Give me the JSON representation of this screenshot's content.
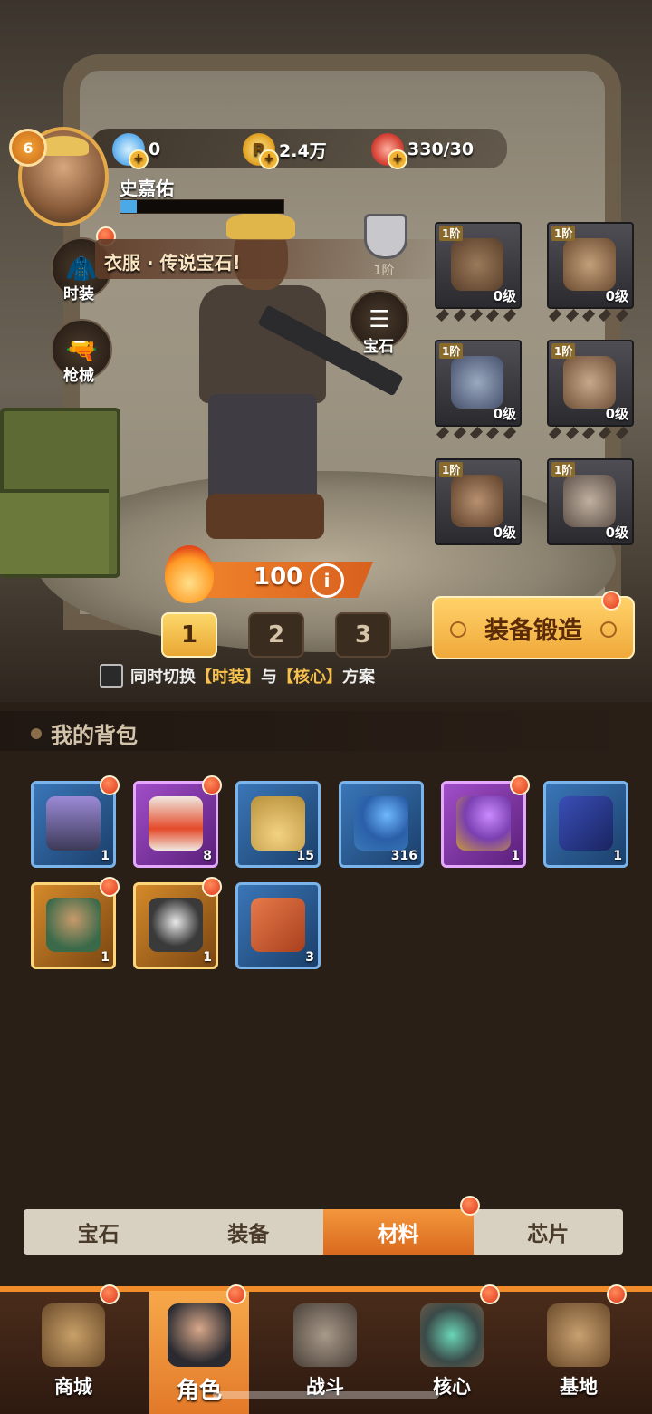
{
  "player": {
    "level": "6",
    "name": "史嘉佑",
    "exp_fraction": 0.1
  },
  "resources": [
    {
      "icon": "diamond-icon",
      "value": "0"
    },
    {
      "icon": "coin-icon",
      "value": "2.4万"
    },
    {
      "icon": "meat-stamina-icon",
      "value": "330/30"
    }
  ],
  "side_buttons": {
    "outfit": "时装",
    "weapon": "枪械",
    "gem": "宝石"
  },
  "notice": {
    "text": "衣服 · 传说宝石!",
    "tier": "1阶"
  },
  "equipment": [
    {
      "slot": "helmet",
      "tier": "1阶",
      "level": "0级"
    },
    {
      "slot": "gauntlets",
      "tier": "1阶",
      "level": "0级"
    },
    {
      "slot": "armor",
      "tier": "1阶",
      "level": "0级"
    },
    {
      "slot": "pants",
      "tier": "1阶",
      "level": "0级"
    },
    {
      "slot": "boots",
      "tier": "1阶",
      "level": "0级"
    },
    {
      "slot": "gloves",
      "tier": "1阶",
      "level": "0级"
    }
  ],
  "power": {
    "value": "100",
    "info": "i"
  },
  "presets": [
    "1",
    "2",
    "3"
  ],
  "forge": {
    "label": "装备锻造"
  },
  "switch_option": {
    "prefix": "同时切换",
    "lb1": "【",
    "part1": "时装",
    "rb1": "】",
    "mid": "与",
    "lb2": "【",
    "part2": "核心",
    "rb2": "】",
    "suffix": "方案"
  },
  "backpack": {
    "title": "我的背包",
    "items": [
      {
        "name": "supply-chest",
        "count": "1",
        "quality": "blue"
      },
      {
        "name": "energy-vial",
        "count": "8",
        "quality": "purple"
      },
      {
        "name": "sand-pile",
        "count": "15",
        "quality": "blue"
      },
      {
        "name": "blue-key",
        "count": "316",
        "quality": "blue"
      },
      {
        "name": "purple-key",
        "count": "1",
        "quality": "purple"
      },
      {
        "name": "glove-card",
        "count": "1",
        "quality": "blue"
      },
      {
        "name": "hero-portrait",
        "count": "1",
        "quality": "gold"
      },
      {
        "name": "pet-portrait",
        "count": "1",
        "quality": "gold"
      },
      {
        "name": "blueprint-card",
        "count": "3",
        "quality": "blue"
      }
    ]
  },
  "category_tabs": [
    "宝石",
    "装备",
    "材料",
    "芯片"
  ],
  "active_category": "材料",
  "nav": [
    "商城",
    "角色",
    "战斗",
    "核心",
    "基地"
  ],
  "active_nav": "角色",
  "colors": {
    "accent": "#f28b2a",
    "gold": "#f7c14c",
    "background": "#2a1f17"
  }
}
